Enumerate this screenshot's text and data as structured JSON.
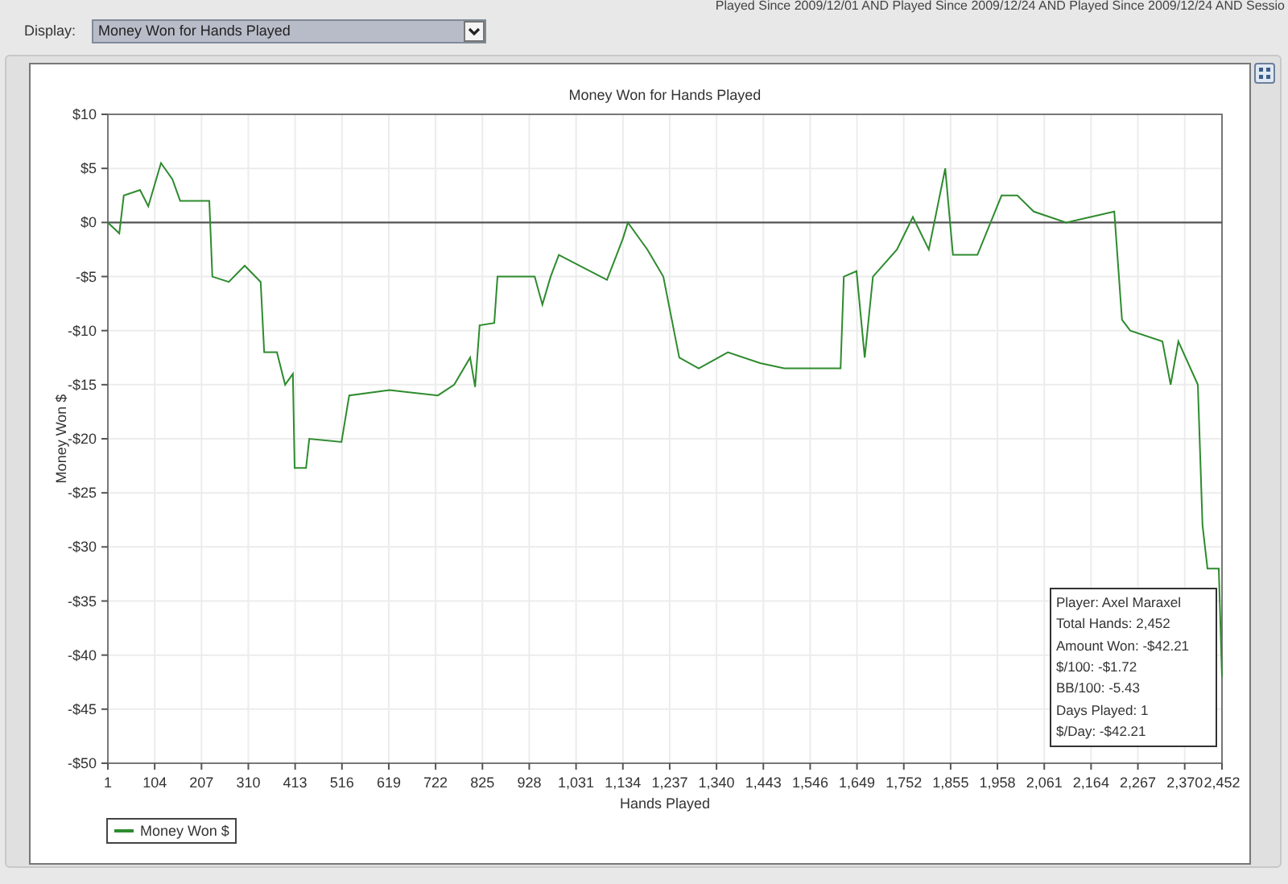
{
  "filter_text": "Played Since 2009/12/01 AND Played Since 2009/12/24 AND Played Since 2009/12/24 AND Sessio",
  "display": {
    "label": "Display:",
    "value": "Money Won for Hands Played"
  },
  "chart": {
    "chart_data": {
      "type": "line",
      "title": "Money Won for Hands Played",
      "xlabel": "Hands Played",
      "ylabel": "Money Won $",
      "x": [
        1,
        26,
        36,
        72,
        90,
        118,
        143,
        160,
        224,
        231,
        267,
        302,
        337,
        345,
        373,
        391,
        408,
        412,
        437,
        444,
        515,
        532,
        621,
        727,
        763,
        798,
        809,
        819,
        851,
        858,
        940,
        957,
        975,
        993,
        1099,
        1134,
        1145,
        1188,
        1223,
        1258,
        1301,
        1365,
        1436,
        1489,
        1613,
        1620,
        1648,
        1666,
        1684,
        1737,
        1772,
        1807,
        1843,
        1860,
        1914,
        1967,
        2002,
        2038,
        2109,
        2215,
        2232,
        2250,
        2321,
        2339,
        2356,
        2399,
        2409,
        2420,
        2445,
        2452
      ],
      "series": [
        {
          "name": "Money Won $",
          "color": "#2e8b2e",
          "values": [
            0,
            -1,
            2.5,
            3,
            1.5,
            5.5,
            4,
            2,
            2,
            -5,
            -5.5,
            -4,
            -5.5,
            -12,
            -12,
            -15,
            -14,
            -22.7,
            -22.7,
            -20,
            -20.3,
            -16,
            -15.5,
            -16,
            -15,
            -12.5,
            -15.2,
            -9.5,
            -9.3,
            -5,
            -5,
            -7.6,
            -5,
            -3,
            -5.3,
            -1.5,
            0,
            -2.5,
            -5,
            -12.5,
            -13.5,
            -12,
            -13,
            -13.5,
            -13.5,
            -5,
            -4.5,
            -12.5,
            -5,
            -2.5,
            0.5,
            -2.5,
            5,
            -3,
            -3,
            2.5,
            2.5,
            1,
            0,
            1,
            -9,
            -10,
            -11,
            -15,
            -11,
            -15,
            -28,
            -32,
            -32,
            -42
          ]
        }
      ],
      "grid": true,
      "xlim": [
        1,
        2452
      ],
      "ylim": [
        -50,
        10
      ],
      "xticks": [
        {
          "value": 1,
          "label": "1"
        },
        {
          "value": 104,
          "label": "104"
        },
        {
          "value": 207,
          "label": "207"
        },
        {
          "value": 310,
          "label": "310"
        },
        {
          "value": 413,
          "label": "413"
        },
        {
          "value": 516,
          "label": "516"
        },
        {
          "value": 619,
          "label": "619"
        },
        {
          "value": 722,
          "label": "722"
        },
        {
          "value": 825,
          "label": "825"
        },
        {
          "value": 928,
          "label": "928"
        },
        {
          "value": 1031,
          "label": "1,031"
        },
        {
          "value": 1134,
          "label": "1,134"
        },
        {
          "value": 1237,
          "label": "1,237"
        },
        {
          "value": 1340,
          "label": "1,340"
        },
        {
          "value": 1443,
          "label": "1,443"
        },
        {
          "value": 1546,
          "label": "1,546"
        },
        {
          "value": 1649,
          "label": "1,649"
        },
        {
          "value": 1752,
          "label": "1,752"
        },
        {
          "value": 1855,
          "label": "1,855"
        },
        {
          "value": 1958,
          "label": "1,958"
        },
        {
          "value": 2061,
          "label": "2,061"
        },
        {
          "value": 2164,
          "label": "2,164"
        },
        {
          "value": 2267,
          "label": "2,267"
        },
        {
          "value": 2370,
          "label": "2,370"
        },
        {
          "value": 2452,
          "label": "2,452"
        }
      ],
      "yticks": [
        {
          "value": 10,
          "label": "$10"
        },
        {
          "value": 5,
          "label": "$5"
        },
        {
          "value": 0,
          "label": "$0"
        },
        {
          "value": -5,
          "label": "-$5"
        },
        {
          "value": -10,
          "label": "-$10"
        },
        {
          "value": -15,
          "label": "-$15"
        },
        {
          "value": -20,
          "label": "-$20"
        },
        {
          "value": -25,
          "label": "-$25"
        },
        {
          "value": -30,
          "label": "-$30"
        },
        {
          "value": -35,
          "label": "-$35"
        },
        {
          "value": -40,
          "label": "-$40"
        },
        {
          "value": -45,
          "label": "-$45"
        },
        {
          "value": -50,
          "label": "-$50"
        }
      ]
    },
    "stats": [
      "Player: Axel Maraxel",
      "Total Hands: 2,452",
      "Amount Won: -$42.21",
      "$/100: -$1.72",
      "BB/100: -5.43",
      "Days Played: 1",
      "$/Day: -$42.21"
    ]
  }
}
